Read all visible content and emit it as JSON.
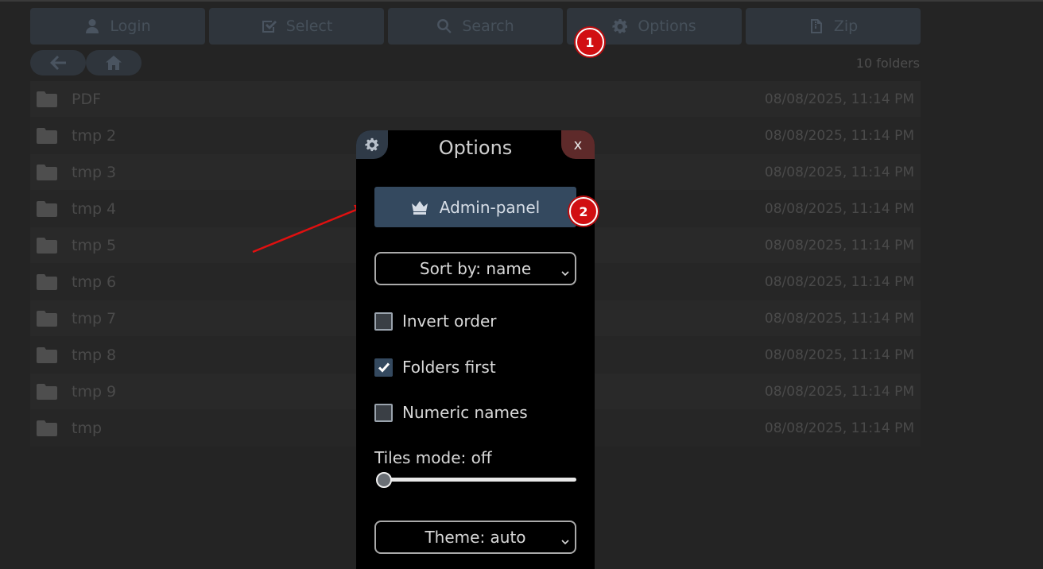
{
  "toolbar": {
    "buttons": [
      {
        "label": "Login",
        "icon": "user-icon"
      },
      {
        "label": "Select",
        "icon": "checkbox-icon"
      },
      {
        "label": "Search",
        "icon": "search-icon"
      },
      {
        "label": "Options",
        "icon": "gear-icon"
      },
      {
        "label": "Zip",
        "icon": "zip-file-icon"
      }
    ]
  },
  "nav": {
    "back_icon": "arrow-left-icon",
    "home_icon": "home-icon"
  },
  "folder_count": "10 folders",
  "files": [
    {
      "name": "PDF",
      "date": "08/08/2025, 11:14 PM"
    },
    {
      "name": "tmp 2",
      "date": "08/08/2025, 11:14 PM"
    },
    {
      "name": "tmp 3",
      "date": "08/08/2025, 11:14 PM"
    },
    {
      "name": "tmp 4",
      "date": "08/08/2025, 11:14 PM"
    },
    {
      "name": "tmp 5",
      "date": "08/08/2025, 11:14 PM"
    },
    {
      "name": "tmp 6",
      "date": "08/08/2025, 11:14 PM"
    },
    {
      "name": "tmp 7",
      "date": "08/08/2025, 11:14 PM"
    },
    {
      "name": "tmp 8",
      "date": "08/08/2025, 11:14 PM"
    },
    {
      "name": "tmp 9",
      "date": "08/08/2025, 11:14 PM"
    },
    {
      "name": "tmp",
      "date": "08/08/2025, 11:14 PM"
    }
  ],
  "dialog": {
    "title": "Options",
    "close_label": "x",
    "admin_label": "Admin-panel",
    "sort_value": "Sort by: name",
    "invert_label": "Invert order",
    "invert_checked": false,
    "folders_first_label": "Folders first",
    "folders_first_checked": true,
    "numeric_label": "Numeric names",
    "numeric_checked": false,
    "tiles_label": "Tiles mode: off",
    "tiles_value": 0,
    "theme_value": "Theme: auto"
  },
  "markers": {
    "m1": "1",
    "m2": "2"
  },
  "colors": {
    "background": "#242424",
    "dialog": "#000000",
    "accent": "#34495f",
    "close": "#5e2a2a",
    "marker": "#d10f12"
  }
}
